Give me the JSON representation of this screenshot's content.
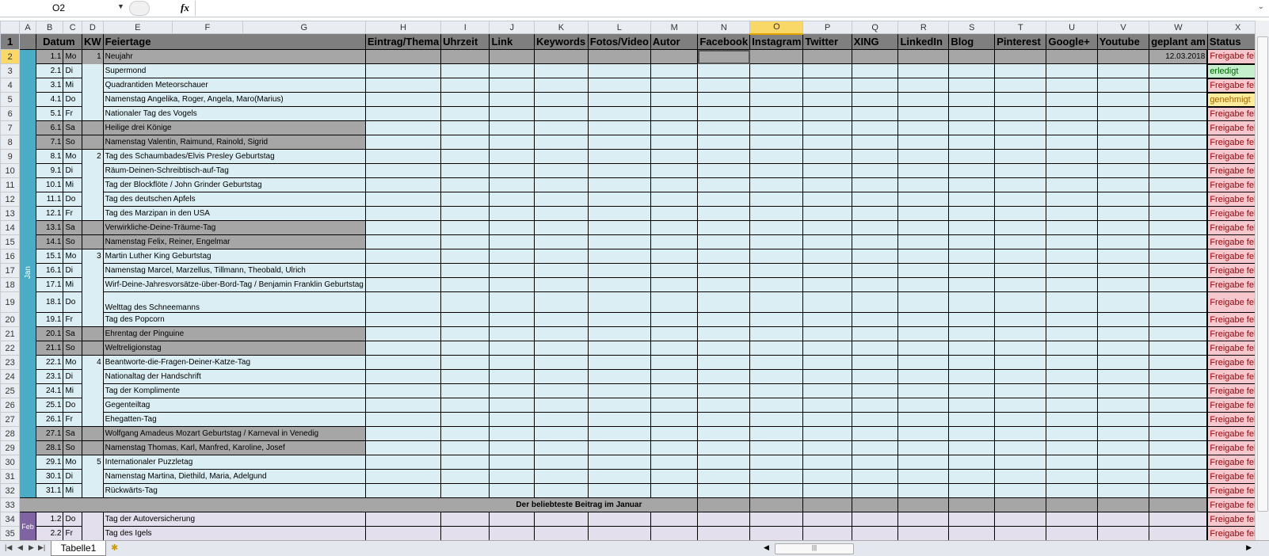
{
  "formula_bar": {
    "name_box": "O2",
    "fx": "fx",
    "formula": ""
  },
  "columns": [
    "A",
    "B",
    "C",
    "D",
    "E",
    "F",
    "G",
    "H",
    "I",
    "J",
    "K",
    "L",
    "M",
    "N",
    "O",
    "P",
    "Q",
    "R",
    "S",
    "T",
    "U",
    "V",
    "W",
    "X"
  ],
  "selected_column": "O",
  "selected_row": 2,
  "header": {
    "datum": "Datum",
    "kw": "KW",
    "feiertage": "Feiertage",
    "cols": [
      "Eintrag/Thema",
      "Uhrzeit",
      "Link",
      "Keywords",
      "Fotos/Video",
      "Autor",
      "Facebook",
      "Instagram",
      "Twitter",
      "XING",
      "LinkedIn",
      "Blog",
      "Pinterest",
      "Google+",
      "Youtube",
      "geplant am"
    ],
    "status": "Status"
  },
  "month_labels": {
    "jan": "Jan",
    "feb": "Feb"
  },
  "rows": [
    {
      "n": 2,
      "date": "1.1",
      "day": "Mo",
      "kw": "1",
      "title": "Neujahr",
      "type": "holiday",
      "planned": "12.03.2018",
      "status": "Freigabe fehlt"
    },
    {
      "n": 3,
      "date": "2.1",
      "day": "Di",
      "title": "Supermond",
      "status": "erledigt"
    },
    {
      "n": 4,
      "date": "3.1",
      "day": "Mi",
      "title": "Quadrantiden Meteorschauer",
      "status": "Freigabe fehlt"
    },
    {
      "n": 5,
      "date": "4.1",
      "day": "Do",
      "title": "Namenstag Angelika, Roger, Angela, Maro(Marius)",
      "status": "genehmigt"
    },
    {
      "n": 6,
      "date": "5.1",
      "day": "Fr",
      "title": "Nationaler Tag des Vogels",
      "status": "Freigabe fehlt"
    },
    {
      "n": 7,
      "date": "6.1",
      "day": "Sa",
      "title": "Heilige drei Könige",
      "type": "weekend",
      "status": "Freigabe fehlt"
    },
    {
      "n": 8,
      "date": "7.1",
      "day": "So",
      "title": "Namenstag Valentin, Raimund, Rainold, Sigrid",
      "type": "weekend",
      "status": "Freigabe fehlt"
    },
    {
      "n": 9,
      "date": "8.1",
      "day": "Mo",
      "kw": "2",
      "title": "Tag des Schaumbades/Elvis Presley Geburtstag",
      "status": "Freigabe fehlt"
    },
    {
      "n": 10,
      "date": "9.1",
      "day": "Di",
      "title": "Räum-Deinen-Schreibtisch-auf-Tag",
      "status": "Freigabe fehlt"
    },
    {
      "n": 11,
      "date": "10.1",
      "day": "Mi",
      "title": "Tag der Blockflöte / John Grinder Geburtstag",
      "status": "Freigabe fehlt"
    },
    {
      "n": 12,
      "date": "11.1",
      "day": "Do",
      "title": "Tag des deutschen Apfels",
      "status": "Freigabe fehlt"
    },
    {
      "n": 13,
      "date": "12.1",
      "day": "Fr",
      "title": "Tag des Marzipan in den USA",
      "status": "Freigabe fehlt"
    },
    {
      "n": 14,
      "date": "13.1",
      "day": "Sa",
      "title": "Verwirkliche-Deine-Träume-Tag",
      "type": "weekend",
      "status": "Freigabe fehlt"
    },
    {
      "n": 15,
      "date": "14.1",
      "day": "So",
      "title": "Namenstag Felix, Reiner, Engelmar",
      "type": "weekend",
      "status": "Freigabe fehlt"
    },
    {
      "n": 16,
      "date": "15.1",
      "day": "Mo",
      "kw": "3",
      "title": "Martin Luther King Geburtstag",
      "status": "Freigabe fehlt"
    },
    {
      "n": 17,
      "date": "16.1",
      "day": "Di",
      "title": "Namenstag Marcel, Marzellus, Tillmann, Theobald, Ulrich",
      "status": "Freigabe fehlt"
    },
    {
      "n": 18,
      "date": "17.1",
      "day": "Mi",
      "title": "Wirf-Deine-Jahresvorsätze-über-Bord-Tag  / Benjamin Franklin Geburtstag",
      "status": "Freigabe fehlt"
    },
    {
      "n": 19,
      "date": "18.1",
      "day": "Do",
      "title": "Welttag des Schneemanns",
      "tall": true,
      "status": "Freigabe fehlt"
    },
    {
      "n": 20,
      "date": "19.1",
      "day": "Fr",
      "title": "Tag des Popcorn",
      "status": "Freigabe fehlt"
    },
    {
      "n": 21,
      "date": "20.1",
      "day": "Sa",
      "title": "Ehrentag der Pinguine",
      "type": "weekend",
      "status": "Freigabe fehlt"
    },
    {
      "n": 22,
      "date": "21.1",
      "day": "So",
      "title": "Weltreligionstag",
      "type": "weekend",
      "status": "Freigabe fehlt"
    },
    {
      "n": 23,
      "date": "22.1",
      "day": "Mo",
      "kw": "4",
      "title": "Beantworte-die-Fragen-Deiner-Katze-Tag",
      "status": "Freigabe fehlt"
    },
    {
      "n": 24,
      "date": "23.1",
      "day": "Di",
      "title": "Nationaltag der Handschrift",
      "status": "Freigabe fehlt"
    },
    {
      "n": 25,
      "date": "24.1",
      "day": "Mi",
      "title": "Tag der Komplimente",
      "status": "Freigabe fehlt"
    },
    {
      "n": 26,
      "date": "25.1",
      "day": "Do",
      "title": "Gegenteiltag",
      "status": "Freigabe fehlt"
    },
    {
      "n": 27,
      "date": "26.1",
      "day": "Fr",
      "title": "Ehegatten-Tag",
      "status": "Freigabe fehlt"
    },
    {
      "n": 28,
      "date": "27.1",
      "day": "Sa",
      "title": "Wolfgang Amadeus Mozart  Geburtstag / Karneval in Venedig",
      "type": "weekend",
      "status": "Freigabe fehlt"
    },
    {
      "n": 29,
      "date": "28.1",
      "day": "So",
      "title": "Namenstag Thomas, Karl, Manfred, Karoline, Josef",
      "type": "weekend",
      "status": "Freigabe fehlt"
    },
    {
      "n": 30,
      "date": "29.1",
      "day": "Mo",
      "kw": "5",
      "title": "Internationaler Puzzletag",
      "status": "Freigabe fehlt"
    },
    {
      "n": 31,
      "date": "30.1",
      "day": "Di",
      "title": "Namenstag Martina, Diethild, Maria, Adelgund",
      "status": "Freigabe fehlt"
    },
    {
      "n": 32,
      "date": "31.1",
      "day": "Mi",
      "title": "Rückwärts-Tag",
      "status": "Freigabe fehlt"
    },
    {
      "n": 33,
      "summary": "Der beliebteste Beitrag im Januar",
      "status": "Freigabe fehlt"
    },
    {
      "n": 34,
      "date": "1.2",
      "day": "Do",
      "title": "Tag der Autoversicherung",
      "month": "feb",
      "status": "Freigabe fehlt"
    },
    {
      "n": 35,
      "date": "2.2",
      "day": "Fr",
      "title": "Tag des Igels",
      "month": "feb",
      "status": "Freigabe fehlt"
    }
  ],
  "sheet_tabs": [
    "Tabelle1"
  ],
  "colors": {
    "jan_band": "#4bacc6",
    "feb_band": "#8064a2",
    "row_bg": "#daeef3",
    "weekend": "#a6a6a6",
    "header": "#7f7f7f"
  }
}
